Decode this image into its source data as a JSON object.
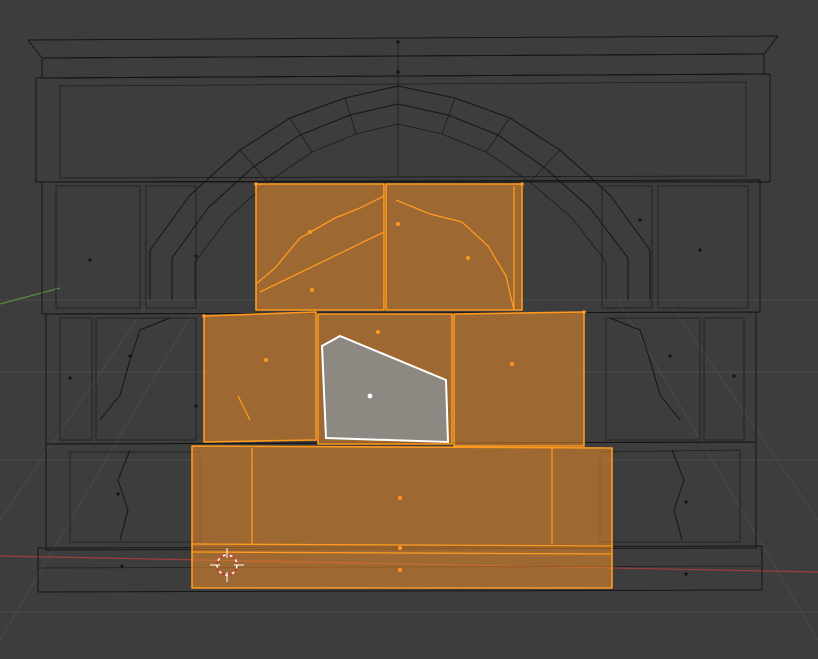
{
  "viewport": {
    "mode": "wireframe",
    "background": "#3d3d3d",
    "selection_color": "#ff9a1e",
    "active_color": "#ffffff",
    "axis_x_color": "#a03c3c",
    "axis_y_color": "#5a8a3a"
  },
  "icons": {
    "cursor": "3d-cursor-icon",
    "origin": "object-origin-icon"
  }
}
